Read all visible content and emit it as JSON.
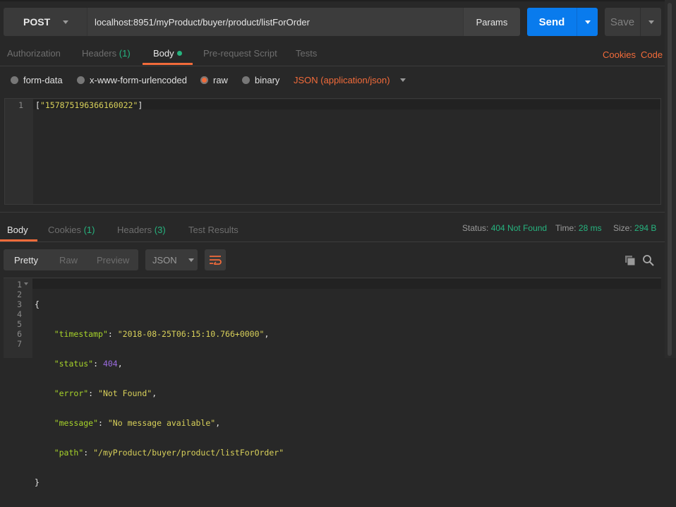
{
  "request": {
    "method": "POST",
    "url": "localhost:8951/myProduct/buyer/product/listForOrder",
    "params_label": "Params",
    "send_label": "Send",
    "save_label": "Save"
  },
  "request_tabs": [
    {
      "label": "Authorization"
    },
    {
      "label": "Headers",
      "count": "(1)"
    },
    {
      "label": "Body",
      "active": true
    },
    {
      "label": "Pre-request Script"
    },
    {
      "label": "Tests"
    }
  ],
  "request_links": {
    "cookies": "Cookies",
    "code": "Code"
  },
  "body_types": {
    "options": [
      "form-data",
      "x-www-form-urlencoded",
      "raw",
      "binary"
    ],
    "selected": "raw",
    "content_type": "JSON (application/json)"
  },
  "request_body": {
    "line_number": "1",
    "open": "[",
    "value": "\"157875196366160022\"",
    "close": "]"
  },
  "response_tabs": [
    {
      "label": "Body",
      "active": true
    },
    {
      "label": "Cookies",
      "count": "(1)"
    },
    {
      "label": "Headers",
      "count": "(3)"
    },
    {
      "label": "Test Results"
    }
  ],
  "response_status": {
    "status_label": "Status:",
    "status": "404 Not Found",
    "time_label": "Time:",
    "time": "28 ms",
    "size_label": "Size:",
    "size": "294 B"
  },
  "response_view": {
    "modes": [
      "Pretty",
      "Raw",
      "Preview"
    ],
    "selected": "Pretty",
    "format": "JSON"
  },
  "response_body": {
    "line_numbers": [
      "1",
      "2",
      "3",
      "4",
      "5",
      "6",
      "7"
    ],
    "open": "{",
    "close": "}",
    "fields": [
      {
        "key": "\"timestamp\"",
        "value": "\"2018-08-25T06:15:10.766+0000\"",
        "type": "string",
        "comma": ","
      },
      {
        "key": "\"status\"",
        "value": "404",
        "type": "number",
        "comma": ","
      },
      {
        "key": "\"error\"",
        "value": "\"Not Found\"",
        "type": "string",
        "comma": ","
      },
      {
        "key": "\"message\"",
        "value": "\"No message available\"",
        "type": "string",
        "comma": ","
      },
      {
        "key": "\"path\"",
        "value": "\"/myProduct/buyer/product/listForOrder\"",
        "type": "string",
        "comma": ""
      }
    ]
  },
  "colors": {
    "accent": "#f26b3a",
    "send": "#097bed",
    "success": "#26b47f"
  }
}
